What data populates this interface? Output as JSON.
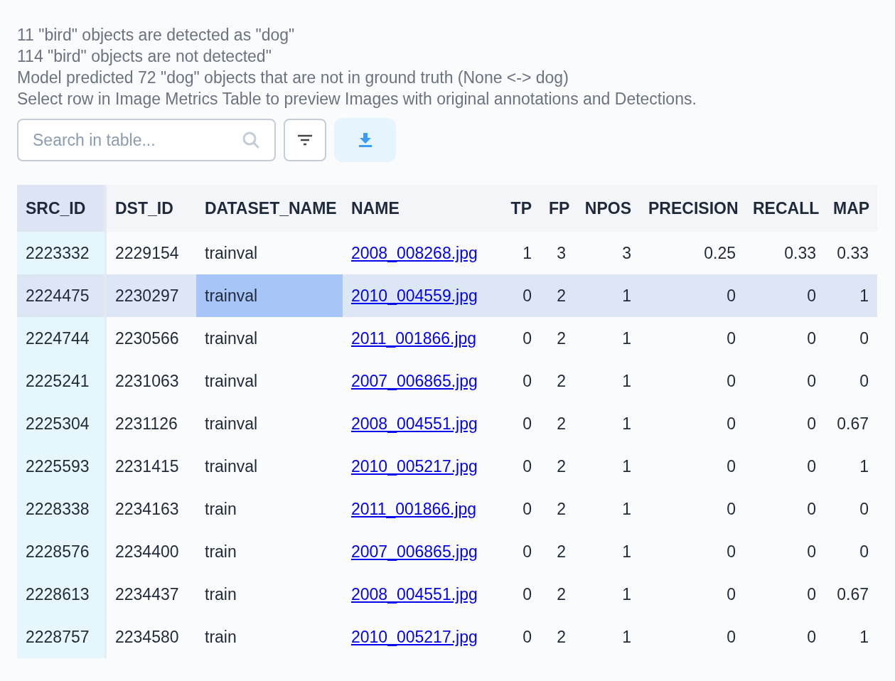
{
  "summary": [
    "11 \"bird\" objects are detected as \"dog\"",
    "114 \"bird\" objects are not detected\"",
    "Model predicted 72 \"dog\" objects that are not in ground truth (None <-> dog)",
    "Select row in Image Metrics Table to preview Images with original annotations and Detections."
  ],
  "toolbar": {
    "search": {
      "placeholder": "Search in table..."
    }
  },
  "table": {
    "columns": [
      "SRC_ID",
      "DST_ID",
      "DATASET_NAME",
      "NAME",
      "TP",
      "FP",
      "NPOS",
      "PRECISION",
      "RECALL",
      "MAP"
    ],
    "rows": [
      {
        "selected": false,
        "cells": [
          {
            "text": "2223332",
            "focused": false
          },
          {
            "text": "2229154",
            "focused": false
          },
          {
            "text": "trainval",
            "focused": false
          },
          {
            "text": "2008_008268.jpg",
            "focused": false
          },
          {
            "text": "1",
            "focused": false
          },
          {
            "text": "3",
            "focused": false
          },
          {
            "text": "3",
            "focused": false
          },
          {
            "text": "0.25",
            "focused": false
          },
          {
            "text": "0.33",
            "focused": false
          },
          {
            "text": "0.33",
            "focused": false
          }
        ]
      },
      {
        "selected": true,
        "cells": [
          {
            "text": "2224475",
            "focused": false
          },
          {
            "text": "2230297",
            "focused": false
          },
          {
            "text": "trainval",
            "focused": true
          },
          {
            "text": "2010_004559.jpg",
            "focused": false
          },
          {
            "text": "0",
            "focused": false
          },
          {
            "text": "2",
            "focused": false
          },
          {
            "text": "1",
            "focused": false
          },
          {
            "text": "0",
            "focused": false
          },
          {
            "text": "0",
            "focused": false
          },
          {
            "text": "1",
            "focused": false
          }
        ]
      },
      {
        "selected": false,
        "cells": [
          {
            "text": "2224744",
            "focused": false
          },
          {
            "text": "2230566",
            "focused": false
          },
          {
            "text": "trainval",
            "focused": false
          },
          {
            "text": "2011_001866.jpg",
            "focused": false
          },
          {
            "text": "0",
            "focused": false
          },
          {
            "text": "2",
            "focused": false
          },
          {
            "text": "1",
            "focused": false
          },
          {
            "text": "0",
            "focused": false
          },
          {
            "text": "0",
            "focused": false
          },
          {
            "text": "0",
            "focused": false
          }
        ]
      },
      {
        "selected": false,
        "cells": [
          {
            "text": "2225241",
            "focused": false
          },
          {
            "text": "2231063",
            "focused": false
          },
          {
            "text": "trainval",
            "focused": false
          },
          {
            "text": "2007_006865.jpg",
            "focused": false
          },
          {
            "text": "0",
            "focused": false
          },
          {
            "text": "2",
            "focused": false
          },
          {
            "text": "1",
            "focused": false
          },
          {
            "text": "0",
            "focused": false
          },
          {
            "text": "0",
            "focused": false
          },
          {
            "text": "0",
            "focused": false
          }
        ]
      },
      {
        "selected": false,
        "cells": [
          {
            "text": "2225304",
            "focused": false
          },
          {
            "text": "2231126",
            "focused": false
          },
          {
            "text": "trainval",
            "focused": false
          },
          {
            "text": "2008_004551.jpg",
            "focused": false
          },
          {
            "text": "0",
            "focused": false
          },
          {
            "text": "2",
            "focused": false
          },
          {
            "text": "1",
            "focused": false
          },
          {
            "text": "0",
            "focused": false
          },
          {
            "text": "0",
            "focused": false
          },
          {
            "text": "0.67",
            "focused": false
          }
        ]
      },
      {
        "selected": false,
        "cells": [
          {
            "text": "2225593",
            "focused": false
          },
          {
            "text": "2231415",
            "focused": false
          },
          {
            "text": "trainval",
            "focused": false
          },
          {
            "text": "2010_005217.jpg",
            "focused": false
          },
          {
            "text": "0",
            "focused": false
          },
          {
            "text": "2",
            "focused": false
          },
          {
            "text": "1",
            "focused": false
          },
          {
            "text": "0",
            "focused": false
          },
          {
            "text": "0",
            "focused": false
          },
          {
            "text": "1",
            "focused": false
          }
        ]
      },
      {
        "selected": false,
        "cells": [
          {
            "text": "2228338",
            "focused": false
          },
          {
            "text": "2234163",
            "focused": false
          },
          {
            "text": "train",
            "focused": false
          },
          {
            "text": "2011_001866.jpg",
            "focused": false
          },
          {
            "text": "0",
            "focused": false
          },
          {
            "text": "2",
            "focused": false
          },
          {
            "text": "1",
            "focused": false
          },
          {
            "text": "0",
            "focused": false
          },
          {
            "text": "0",
            "focused": false
          },
          {
            "text": "0",
            "focused": false
          }
        ]
      },
      {
        "selected": false,
        "cells": [
          {
            "text": "2228576",
            "focused": false
          },
          {
            "text": "2234400",
            "focused": false
          },
          {
            "text": "train",
            "focused": false
          },
          {
            "text": "2007_006865.jpg",
            "focused": false
          },
          {
            "text": "0",
            "focused": false
          },
          {
            "text": "2",
            "focused": false
          },
          {
            "text": "1",
            "focused": false
          },
          {
            "text": "0",
            "focused": false
          },
          {
            "text": "0",
            "focused": false
          },
          {
            "text": "0",
            "focused": false
          }
        ]
      },
      {
        "selected": false,
        "cells": [
          {
            "text": "2228613",
            "focused": false
          },
          {
            "text": "2234437",
            "focused": false
          },
          {
            "text": "train",
            "focused": false
          },
          {
            "text": "2008_004551.jpg",
            "focused": false
          },
          {
            "text": "0",
            "focused": false
          },
          {
            "text": "2",
            "focused": false
          },
          {
            "text": "1",
            "focused": false
          },
          {
            "text": "0",
            "focused": false
          },
          {
            "text": "0",
            "focused": false
          },
          {
            "text": "0.67",
            "focused": false
          }
        ]
      },
      {
        "selected": false,
        "cells": [
          {
            "text": "2228757",
            "focused": false
          },
          {
            "text": "2234580",
            "focused": false
          },
          {
            "text": "train",
            "focused": false
          },
          {
            "text": "2010_005217.jpg",
            "focused": false
          },
          {
            "text": "0",
            "focused": false
          },
          {
            "text": "2",
            "focused": false
          },
          {
            "text": "1",
            "focused": false
          },
          {
            "text": "0",
            "focused": false
          },
          {
            "text": "0",
            "focused": false
          },
          {
            "text": "1",
            "focused": false
          }
        ]
      }
    ]
  }
}
